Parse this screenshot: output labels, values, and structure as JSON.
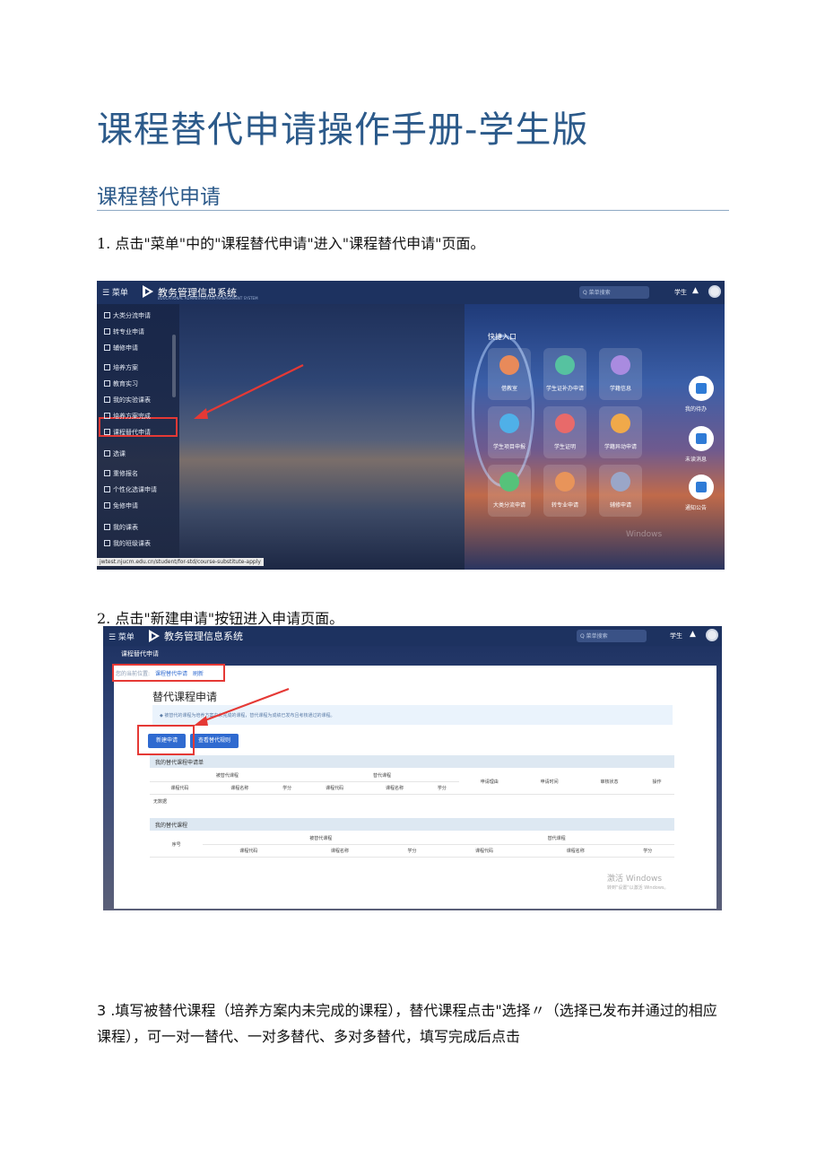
{
  "doc": {
    "title": "课程替代申请操作手册-学生版",
    "section": "课程替代申请",
    "step1": "1. 点击\"菜单\"中的\"课程替代申请\"进入\"课程替代申请\"页面。",
    "step2": "2. 点击\"新建申请\"按钮进入申请页面。",
    "step3": "3  .填写被替代课程（培养方案内未完成的课程），替代课程点击\"选择〃（选择已发布并通过的相应课程），可一对一替代、一对多替代、多对多替代，填写完成后点击"
  },
  "app": {
    "menu_label": "☰ 菜单",
    "system_title": "教务管理信息系统",
    "system_subtitle": "EDUCATIONAL ADMINISTRATION MANAGEMENT SYSTEM",
    "search_placeholder": "Q 菜单搜索",
    "role": "学生",
    "bell_icon": "bell-icon",
    "accent_color": "#2f6ad0",
    "highlight_color": "#e53935"
  },
  "shot1": {
    "sidebar_items": [
      "大类分流申请",
      "转专业申请",
      "辅修申请",
      "培养方案",
      "教育实习",
      "我的实验课表",
      "培养方案完成",
      "课程替代申请",
      "选课",
      "重修报名",
      "个性化选课申请",
      "免修申请",
      "我的课表",
      "我的班级课表"
    ],
    "status_url": "jwtest.njucm.edu.cn/student/for-std/course-substitute-apply",
    "quick_entry_label": "快捷入口",
    "quick_tiles": [
      "借教室",
      "学生证补办申请",
      "学籍信息",
      "学生项目申报",
      "学生证明",
      "学籍异动申请",
      "大类分流申请",
      "转专业申请",
      "辅修申请"
    ],
    "float_buttons": [
      "我的待办",
      "未读消息",
      "通知公告"
    ],
    "watermark": "Windows"
  },
  "shot2": {
    "page_label": "课程替代申请",
    "breadcrumb_prefix": "您的当前位置:",
    "breadcrumb_current": "课程替代申请",
    "breadcrumb_refresh": "刷新",
    "form_title": "替代课程申请",
    "notice": "◆ 被替代的课程为培养方案中未完成的课程，替代课程为成绩已发布且考核通过的课程。",
    "btn_new": "新建申请",
    "btn_rule": "查看替代规则",
    "section_apply": "我的替代课程申请单",
    "apply_group_replaced": "被替代课程",
    "apply_group_replacing": "替代课程",
    "apply_cols": [
      "课程代码",
      "课程名称",
      "学分",
      "课程代码",
      "课程名称",
      "学分",
      "申请理由",
      "申请时间",
      "审核状态",
      "操作"
    ],
    "no_data": "无数据",
    "section_courses": "我的替代课程",
    "courses_cols": [
      "序号",
      "课程代码",
      "课程名称",
      "学分",
      "课程代码",
      "课程名称",
      "学分"
    ],
    "watermark": "激活 Windows",
    "watermark_sub": "转到\"设置\"以激活 Windows。"
  }
}
